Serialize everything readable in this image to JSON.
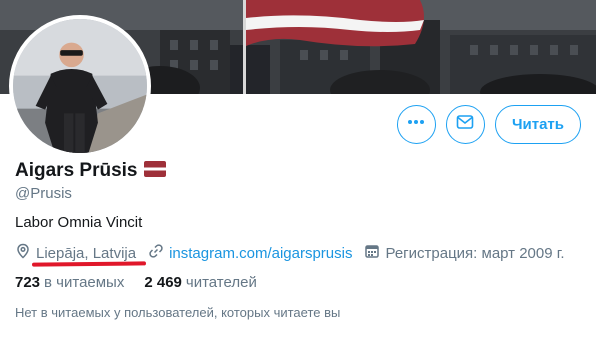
{
  "profile": {
    "display_name": "Aigars Prūsis",
    "handle": "@Prusis",
    "bio": "Labor Omnia Vincit",
    "location": "Liepāja, Latvija",
    "website": "instagram.com/aigarsprusis",
    "joined": "Регистрация: март 2009 г."
  },
  "actions": {
    "follow_label": "Читать"
  },
  "stats": {
    "following_count": "723",
    "following_label": "в читаемых",
    "followers_count": "2 469",
    "followers_label": "читателей"
  },
  "mutual_note": "Нет в читаемых у пользователей, которых читаете вы",
  "colors": {
    "accent": "#1da1f2",
    "link": "#1b95e0",
    "secondary_text": "#657786",
    "flag_red": "#9e3039",
    "annotation_red": "#e0172a"
  },
  "icons": {
    "more": "more-dots-icon",
    "message": "envelope-icon",
    "location": "location-pin-icon",
    "website": "link-icon",
    "joined": "calendar-icon",
    "flag": "latvia-flag-icon"
  }
}
